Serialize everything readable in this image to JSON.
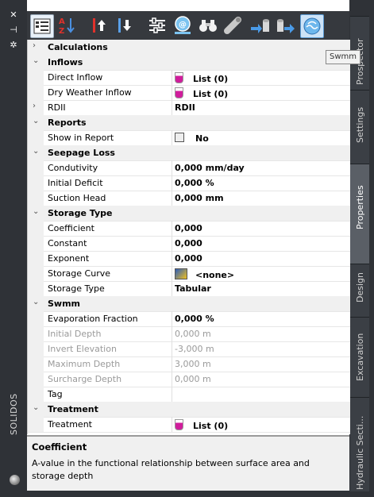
{
  "toolbar": {
    "buttons": [
      {
        "name": "categorized-view-icon"
      },
      {
        "name": "sort-alphabetical-icon"
      },
      {
        "name": "move-up-icon"
      },
      {
        "name": "move-down-icon"
      },
      {
        "name": "sliders-icon"
      },
      {
        "name": "network-globe-icon"
      },
      {
        "name": "binoculars-icon"
      },
      {
        "name": "pipe-icon"
      },
      {
        "name": "arrow-to-node-icon"
      },
      {
        "name": "node-arrow-icon"
      },
      {
        "name": "swmm-icon"
      }
    ],
    "tooltip": "Swmm"
  },
  "palette": {
    "title": "SOLIDOS"
  },
  "tabs": [
    {
      "label": "Prospector"
    },
    {
      "label": "Settings"
    },
    {
      "label": "Properties"
    },
    {
      "label": "Design"
    },
    {
      "label": "Excavation"
    },
    {
      "label": "Hydraulic Secti..."
    }
  ],
  "grid": {
    "rows": [
      {
        "type": "cat",
        "name": "Calculations",
        "chev": "›"
      },
      {
        "type": "cat",
        "name": "Inflows",
        "chev": "⌄"
      },
      {
        "type": "prop",
        "name": "Direct Inflow",
        "value": "List (0)",
        "icon": "flask"
      },
      {
        "type": "prop",
        "name": "Dry Weather Inflow",
        "value": "List (0)",
        "icon": "flask"
      },
      {
        "type": "prop",
        "name": "RDII",
        "value": "RDII",
        "chev": "›"
      },
      {
        "type": "cat",
        "name": "Reports",
        "chev": "⌄"
      },
      {
        "type": "prop",
        "name": "Show in Report",
        "value": "No",
        "icon": "checkbox"
      },
      {
        "type": "cat",
        "name": "Seepage Loss",
        "chev": "⌄"
      },
      {
        "type": "prop",
        "name": "Condutivity",
        "value": "0,000 mm/day"
      },
      {
        "type": "prop",
        "name": "Initial Deficit",
        "value": "0,000 %"
      },
      {
        "type": "prop",
        "name": "Suction Head",
        "value": "0,000 mm"
      },
      {
        "type": "cat",
        "name": "Storage Type",
        "chev": "⌄"
      },
      {
        "type": "prop",
        "name": "Coefficient",
        "value": "0,000"
      },
      {
        "type": "prop",
        "name": "Constant",
        "value": "0,000"
      },
      {
        "type": "prop",
        "name": "Exponent",
        "value": "0,000"
      },
      {
        "type": "prop",
        "name": "Storage Curve",
        "value": "<none>",
        "icon": "curve"
      },
      {
        "type": "prop",
        "name": "Storage Type",
        "value": "Tabular"
      },
      {
        "type": "cat",
        "name": "Swmm",
        "chev": "⌄"
      },
      {
        "type": "prop",
        "name": "Evaporation Fraction",
        "value": "0,000 %"
      },
      {
        "type": "dis",
        "name": "Initial Depth",
        "value": "0,000 m"
      },
      {
        "type": "dis",
        "name": "Invert Elevation",
        "value": "-3,000 m"
      },
      {
        "type": "dis",
        "name": "Maximum Depth",
        "value": "3,000 m"
      },
      {
        "type": "dis",
        "name": "Surcharge Depth",
        "value": "0,000 m"
      },
      {
        "type": "prop",
        "name": "Tag",
        "value": ""
      },
      {
        "type": "cat",
        "name": "Treatment",
        "chev": "⌄"
      },
      {
        "type": "prop",
        "name": "Treatment",
        "value": "List (0)",
        "icon": "flask"
      }
    ]
  },
  "help": {
    "title": "Coefficient",
    "description": "A-value in the functional relationship between surface area and storage depth"
  }
}
